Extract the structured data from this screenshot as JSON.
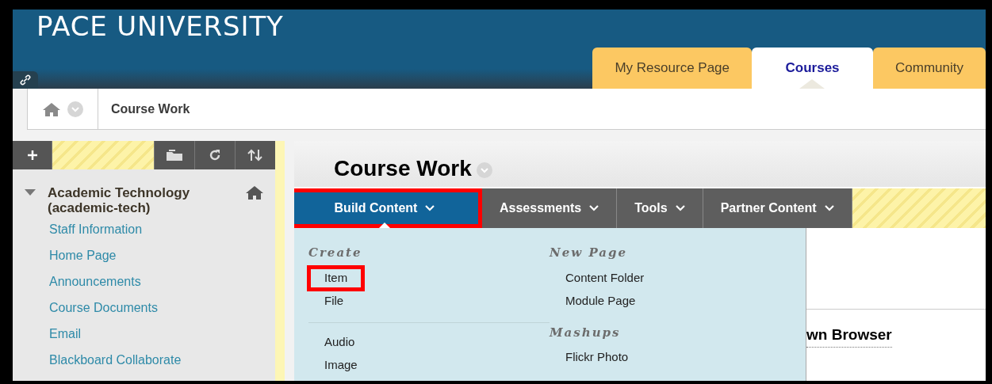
{
  "header": {
    "title": "PACE UNIVERSITY"
  },
  "tabs": [
    {
      "label": "My Resource Page",
      "selected": false
    },
    {
      "label": "Courses",
      "selected": true
    },
    {
      "label": "Community",
      "selected": false
    }
  ],
  "breadcrumb": {
    "current": "Course Work"
  },
  "sidebar": {
    "course": {
      "title": "Academic Technology (academic-tech)",
      "expanded": true
    },
    "items": [
      "Staff Information",
      "Home Page",
      "Announcements",
      "Course Documents",
      "Email",
      "Blackboard Collaborate"
    ]
  },
  "content": {
    "title": "Course Work",
    "menus": [
      {
        "label": "Build Content",
        "selected": true,
        "highlighted": true
      },
      {
        "label": "Assessments",
        "selected": false,
        "highlighted": false
      },
      {
        "label": "Tools",
        "selected": false,
        "highlighted": false
      },
      {
        "label": "Partner Content",
        "selected": false,
        "highlighted": false
      }
    ],
    "dropdown": {
      "columns": [
        {
          "groups": [
            {
              "heading": "Create",
              "items": [
                {
                  "label": "Item",
                  "highlighted": true
                },
                {
                  "label": "File",
                  "highlighted": false
                }
              ]
            },
            {
              "items": [
                {
                  "label": "Audio",
                  "highlighted": false
                },
                {
                  "label": "Image",
                  "highlighted": false
                }
              ]
            }
          ]
        },
        {
          "groups": [
            {
              "heading": "New Page",
              "items": [
                {
                  "label": "Content Folder",
                  "highlighted": false
                },
                {
                  "label": "Module Page",
                  "highlighted": false
                }
              ]
            },
            {
              "heading": "Mashups",
              "items": [
                {
                  "label": "Flickr Photo",
                  "highlighted": false
                }
              ]
            }
          ]
        }
      ]
    },
    "partial_link": "wn Browser"
  }
}
